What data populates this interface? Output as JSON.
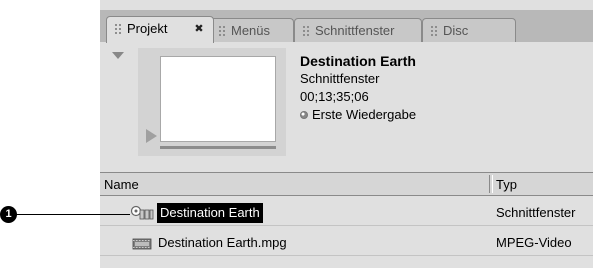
{
  "tabs": [
    {
      "label": "Projekt",
      "active": true
    },
    {
      "label": "Menüs",
      "active": false
    },
    {
      "label": "Schnittfenster",
      "active": false
    },
    {
      "label": "Disc",
      "active": false
    }
  ],
  "close_glyph": "✖",
  "preview": {
    "title": "Destination Earth",
    "subtitle": "Schnittfenster",
    "timecode": "00;13;35;06",
    "first_play": "Erste Wiedergabe"
  },
  "list": {
    "columns": {
      "name": "Name",
      "type": "Typ"
    },
    "rows": [
      {
        "name": "Destination Earth",
        "type": "Schnittfenster",
        "icon": "timeline-icon",
        "selected": true
      },
      {
        "name": "Destination Earth.mpg",
        "type": "MPEG-Video",
        "icon": "film-icon",
        "selected": false
      }
    ]
  },
  "callout": {
    "number": "1"
  }
}
